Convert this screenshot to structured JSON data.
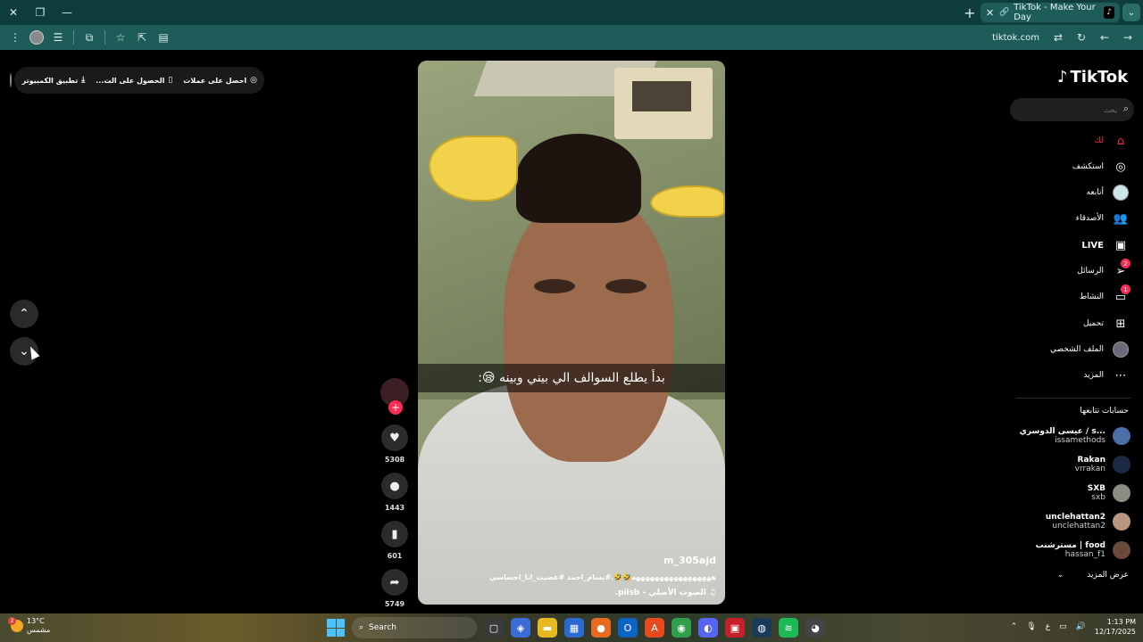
{
  "browser": {
    "tab_title": "TikTok - Make Your Day",
    "url": "tiktok.com",
    "window_controls": [
      "close-icon",
      "restore-icon",
      "minimize-icon"
    ]
  },
  "promo": {
    "items": [
      {
        "label": "احصل على عملات",
        "icon": "coin-icon"
      },
      {
        "label": "الحصول على الت...",
        "icon": "phone-icon"
      },
      {
        "label": "تطبيق الكمبيوتر",
        "icon": "download-icon"
      }
    ]
  },
  "video": {
    "caption": "بدأ يطلع السوالف الي بيني وبينه 😪:",
    "username": "m_305ajd",
    "description": "هههههههههههههههههه🤣🤣.#بسام_احمد #عصيت_انا_احساسي",
    "music": "الصوت الأصلي - piisb.",
    "likes": "5308",
    "comments": "1443",
    "saves": "601",
    "shares": "5749"
  },
  "sidebar": {
    "logo": "TikTok",
    "search_placeholder": "بحث",
    "nav": [
      {
        "label": "لك",
        "icon": "home-icon",
        "active": true
      },
      {
        "label": "استكشف",
        "icon": "compass-icon"
      },
      {
        "label": "أتابعه",
        "icon": "following-avatar"
      },
      {
        "label": "الأصدقاء",
        "icon": "friends-icon"
      },
      {
        "label": "LIVE",
        "icon": "live-icon"
      },
      {
        "label": "الرسائل",
        "icon": "send-icon",
        "badge": "2"
      },
      {
        "label": "النشاط",
        "icon": "activity-icon",
        "badge": "1"
      },
      {
        "label": "تحميل",
        "icon": "upload-icon"
      },
      {
        "label": "الملف الشخصي",
        "icon": "profile-avatar"
      },
      {
        "label": "المزيد",
        "icon": "more-icon"
      }
    ],
    "following_title": "حسابات تتابعها",
    "accounts": [
      {
        "name": "عيسى الدوسري / s...",
        "username": "issamethods",
        "color": "#4c6fa8"
      },
      {
        "name": "Rakan",
        "username": "vrrakan",
        "color": "#1c2a44"
      },
      {
        "name": "SXB",
        "username": "sxb",
        "color": "#8c8c80"
      },
      {
        "name": "unclehattan2",
        "username": "unclehattan2",
        "color": "#b89680"
      },
      {
        "name": "مسترشنب | food",
        "username": "hassan_f1",
        "color": "#6a4a3a"
      }
    ],
    "see_more": "عرض المزيد"
  },
  "taskbar": {
    "temperature": "13°C",
    "weather_label": "مشمس",
    "weather_badge": "2",
    "search_label": "Search",
    "time": "1:13 PM",
    "date": "12/17/2025",
    "lang": "ع"
  },
  "colors": {
    "accent": "#fe2c55",
    "chrome": "#1d5c58",
    "titlebar": "#0f3d3b"
  }
}
